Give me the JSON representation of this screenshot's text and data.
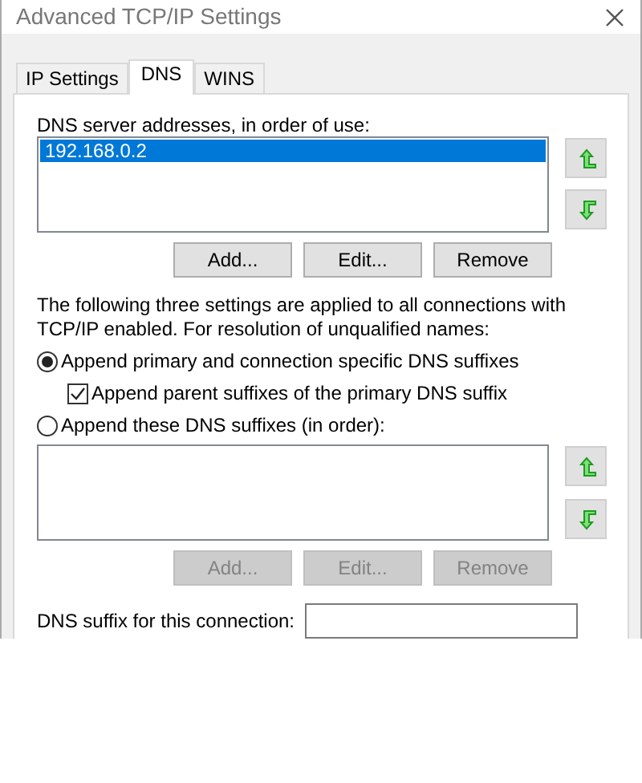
{
  "window": {
    "title": "Advanced TCP/IP Settings"
  },
  "tabs": [
    {
      "label": "IP Settings",
      "selected": false
    },
    {
      "label": "DNS",
      "selected": true
    },
    {
      "label": "WINS",
      "selected": false
    }
  ],
  "dns_servers": {
    "label": "DNS server addresses, in order of use:",
    "items": [
      {
        "text": "192.168.0.2",
        "selected": true
      }
    ],
    "buttons": [
      {
        "label": "Add...",
        "disabled": false
      },
      {
        "label": "Edit...",
        "disabled": false
      },
      {
        "label": "Remove",
        "disabled": false
      }
    ]
  },
  "resolution": {
    "text": "The following three settings are applied to all connections with TCP/IP enabled. For resolution of unqualified names:",
    "options": [
      {
        "kind": "radio",
        "label": "Append primary and connection specific DNS suffixes",
        "checked": true
      },
      {
        "kind": "checkbox",
        "label": "Append parent suffixes of the primary DNS suffix",
        "checked": true
      },
      {
        "kind": "radio",
        "label": "Append these DNS suffixes (in order):",
        "checked": false
      }
    ]
  },
  "dns_suffixes": {
    "buttons": [
      {
        "label": "Add...",
        "disabled": true
      },
      {
        "label": "Edit...",
        "disabled": true
      },
      {
        "label": "Remove",
        "disabled": true
      }
    ]
  },
  "connection_suffix": {
    "label": "DNS suffix for this connection:"
  }
}
